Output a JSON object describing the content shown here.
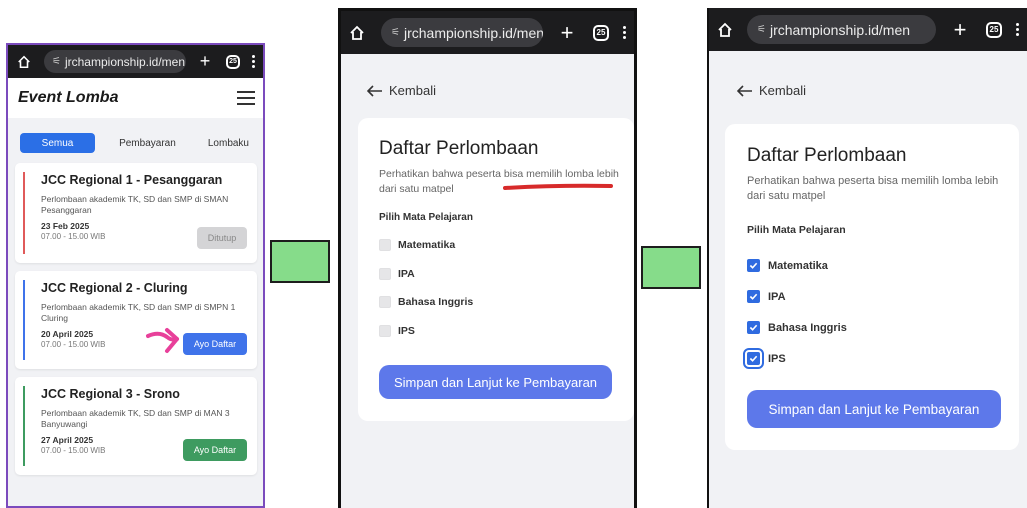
{
  "colors": {
    "tab_active": "#2b6fe6",
    "primary_button": "#5d78ea",
    "checkbox_checked": "#2f6be0",
    "card_accent_red": "#e05a5a",
    "card_accent_blue": "#3f73ea",
    "card_accent_green": "#3e9b60",
    "highlight_box": "#86dc8a",
    "annotation_pink": "#e8409a",
    "annotation_red": "#d72a2a"
  },
  "browser": {
    "url": "jrchampionship.id/men",
    "tab_count": "25",
    "icons": [
      "home-icon",
      "tune-icon",
      "plus-icon",
      "tabs-icon",
      "menu-icon"
    ]
  },
  "screen1": {
    "title": "Event Lomba",
    "tabs": [
      "Semua",
      "Pembayaran",
      "Lombaku"
    ],
    "events": [
      {
        "title": "JCC Regional 1 - Pesanggaran",
        "desc": "Perlombaan akademik TK, SD dan SMP di SMAN Pesanggaran",
        "date": "23 Feb 2025",
        "time": "07.00 - 15.00 WIB",
        "button": "Ditutup",
        "status": "closed"
      },
      {
        "title": "JCC Regional 2 - Cluring",
        "desc": "Perlombaan akademik TK, SD dan SMP di SMPN 1 Cluring",
        "date": "20 April 2025",
        "time": "07.00 - 15.00 WIB",
        "button": "Ayo Daftar",
        "status": "open"
      },
      {
        "title": "JCC Regional 3 - Srono",
        "desc": "Perlombaan akademik TK, SD dan SMP di MAN 3 Banyuwangi",
        "date": "27 April 2025",
        "time": "07.00 - 15.00 WIB",
        "button": "Ayo Daftar",
        "status": "open"
      }
    ]
  },
  "form": {
    "back_label": "Kembali",
    "title": "Daftar Perlombaan",
    "desc": "Perhatikan bahwa peserta bisa memilih lomba lebih dari satu matpel",
    "subject_label": "Pilih Mata Pelajaran",
    "subjects": [
      "Matematika",
      "IPA",
      "Bahasa Inggris",
      "IPS"
    ],
    "submit": "Simpan dan Lanjut ke Pembayaran"
  },
  "screen2": {
    "checked": [
      false,
      false,
      false,
      false
    ]
  },
  "screen3": {
    "checked": [
      true,
      true,
      true,
      true
    ]
  }
}
